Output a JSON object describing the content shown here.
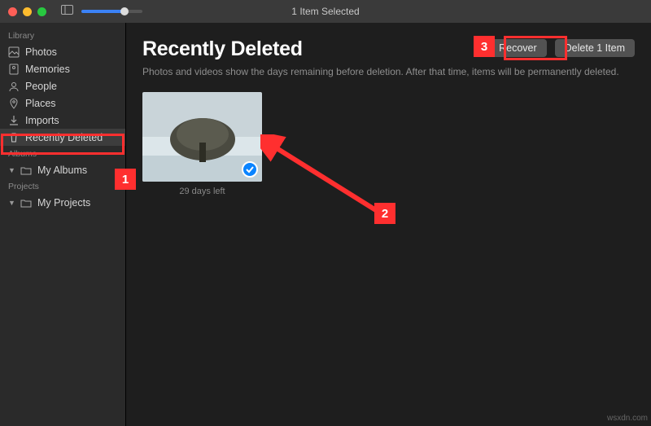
{
  "window": {
    "title": "1 Item Selected"
  },
  "sidebar": {
    "sections": {
      "library": "Library",
      "albums": "Albums",
      "projects": "Projects"
    },
    "items": {
      "photos": "Photos",
      "memories": "Memories",
      "people": "People",
      "places": "Places",
      "imports": "Imports",
      "recently_deleted": "Recently Deleted",
      "my_albums": "My Albums",
      "my_projects": "My Projects"
    }
  },
  "content": {
    "title": "Recently Deleted",
    "subtitle": "Photos and videos show the days remaining before deletion. After that time, items will be permanently deleted.",
    "buttons": {
      "recover": "Recover",
      "delete": "Delete 1 Item"
    },
    "items": [
      {
        "days_left": "29 days left",
        "selected": true
      }
    ]
  },
  "annotations": {
    "label1": "1",
    "label2": "2",
    "label3": "3"
  },
  "watermark": "wsxdn.com"
}
